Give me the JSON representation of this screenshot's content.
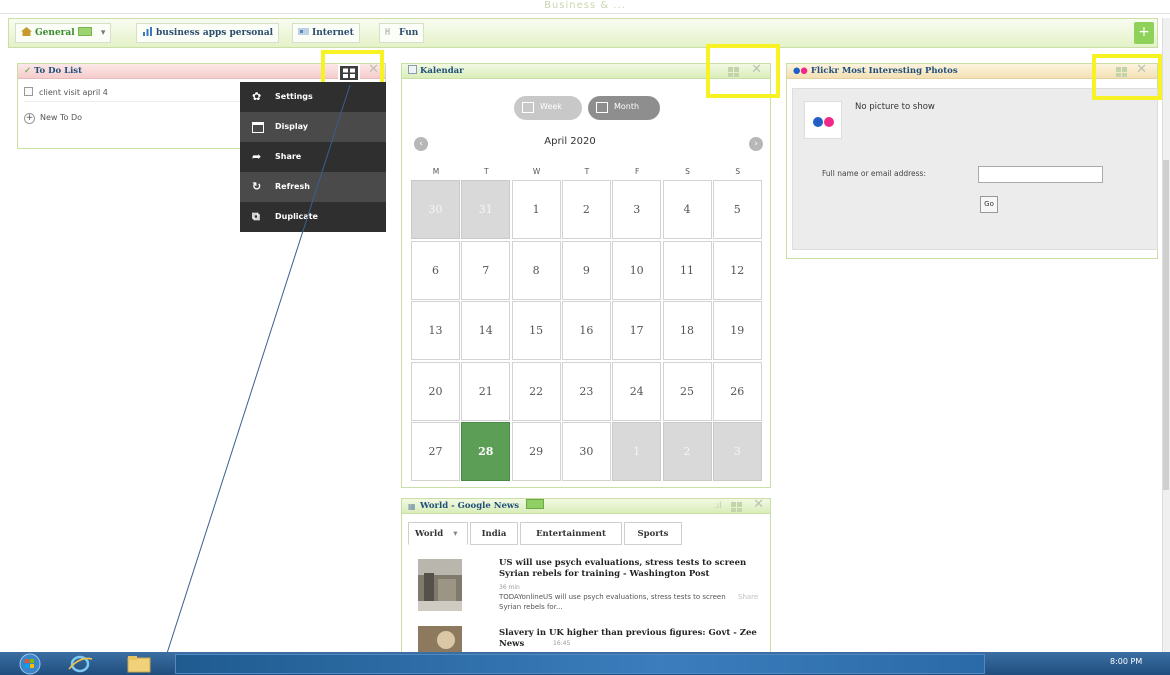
{
  "dashboard_title": "Business & ...",
  "tabs": [
    {
      "label": "General",
      "icon": "home-icon",
      "has_badge": true,
      "has_dropdown": true
    },
    {
      "label": "business apps personal",
      "icon": "bar-chart-icon"
    },
    {
      "label": "Internet",
      "icon": "globe-icon"
    },
    {
      "label": "Fun",
      "icon": "fun-icon"
    }
  ],
  "add_tab_label": "+",
  "todo": {
    "title": "To Do List",
    "items": [
      "client visit april 4"
    ],
    "new_label": "New To Do"
  },
  "widget_menu": {
    "items": [
      "Settings",
      "Display",
      "Share",
      "Refresh",
      "Duplicate"
    ]
  },
  "calendar": {
    "title": "Kalendar",
    "view_week": "Week",
    "view_month": "Month",
    "month_label": "April 2020",
    "weekdays": [
      "M",
      "T",
      "W",
      "T",
      "F",
      "S",
      "S"
    ],
    "weeks": [
      [
        "30",
        "31",
        "1",
        "2",
        "3",
        "4",
        "5"
      ],
      [
        "6",
        "7",
        "8",
        "9",
        "10",
        "11",
        "12"
      ],
      [
        "13",
        "14",
        "15",
        "16",
        "17",
        "18",
        "19"
      ],
      [
        "20",
        "21",
        "22",
        "23",
        "24",
        "25",
        "26"
      ],
      [
        "27",
        "28",
        "29",
        "30",
        "1",
        "2",
        "3"
      ]
    ],
    "today": "28"
  },
  "flickr": {
    "title": "Flickr Most Interesting Photos",
    "no_picture": "No picture to show",
    "field_label": "Full name or email address:",
    "field_value": "",
    "go_label": "Go"
  },
  "news": {
    "title": "World - Google News",
    "tabs": [
      "World",
      "India",
      "Entertainment",
      "Sports"
    ],
    "articles": [
      {
        "headline": "US will use psych evaluations, stress tests to screen Syrian rebels for training - Washington Post",
        "time": "36 min",
        "snippet": "TODAYonlineUS will use psych evaluations, stress tests to screen Syrian rebels for...",
        "share": "Share"
      },
      {
        "headline": "Slavery in UK higher than previous figures: Govt - Zee News",
        "time": "16:45"
      }
    ]
  },
  "taskbar": {
    "clock": "8:00 PM"
  },
  "colors": {
    "highlight": "#f6f223",
    "today": "#5c9e55",
    "accent_green": "#8fd25a",
    "menu_bg": "#4a4a4a"
  }
}
